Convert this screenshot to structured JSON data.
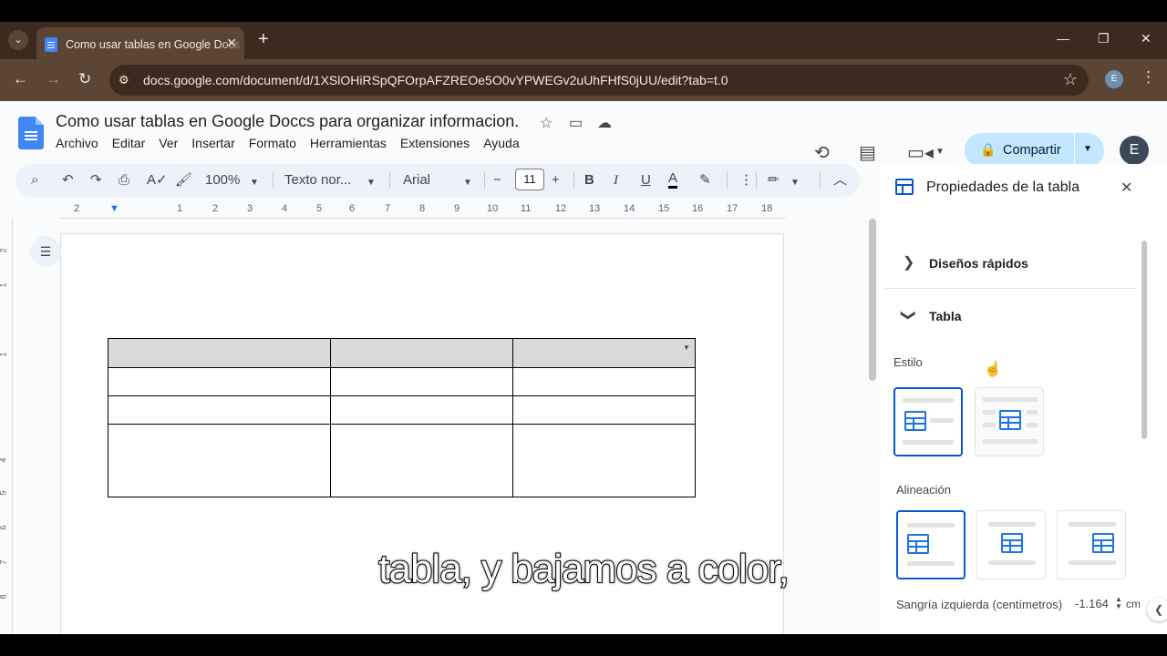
{
  "browser": {
    "tab_title": "Como usar tablas en Google Docs",
    "url": "docs.google.com/document/d/1XSlOHiRSpQFOrpAFZREOe5O0vYPWEGv2uUhFHfS0jUU/edit?tab=t.0",
    "profile_initial": "E"
  },
  "doc": {
    "title": "Como usar tablas en Google Doccs para organizar informacion.",
    "menu": [
      "Archivo",
      "Editar",
      "Ver",
      "Insertar",
      "Formato",
      "Herramientas",
      "Extensiones",
      "Ayuda"
    ],
    "share_label": "Compartir",
    "avatar_initial": "E"
  },
  "toolbar": {
    "zoom": "100%",
    "style": "Texto nor...",
    "font": "Arial",
    "font_size": "11"
  },
  "ruler": {
    "numbers": [
      "2",
      "1",
      "1",
      "2",
      "3",
      "4",
      "5",
      "6",
      "7",
      "8",
      "9",
      "10",
      "11",
      "12",
      "13",
      "14",
      "15",
      "16",
      "17",
      "18"
    ]
  },
  "vruler": {
    "numbers": [
      "2",
      "1",
      "1",
      "4",
      "5",
      "6",
      "7",
      "8"
    ]
  },
  "side_panel": {
    "title": "Propiedades de la tabla",
    "section_quick": "Diseños rápidos",
    "section_table": "Tabla",
    "style_label": "Estilo",
    "alignment_label": "Alineación",
    "indent_label": "Sangría izquierda (centímetros)",
    "indent_value": "-1.164",
    "indent_unit": "cm"
  },
  "subtitle": "tabla, y bajamos a color,",
  "colors": {
    "accent": "#0b57d0",
    "share_bg": "#c2e7ff",
    "chrome_dark": "#3c2a1e",
    "chrome_mid": "#5b4535"
  }
}
